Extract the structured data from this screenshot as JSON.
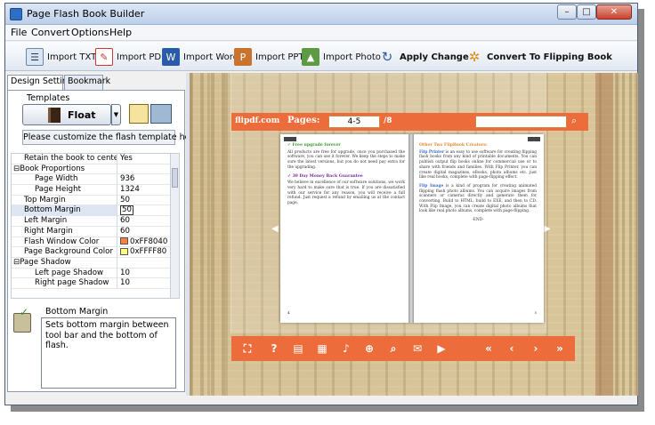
{
  "window": {
    "title": "Page Flash Book Builder",
    "minimize": "–",
    "maximize": "□",
    "close": "✕"
  },
  "menu": [
    "File",
    "Convert",
    "Options",
    "Help"
  ],
  "toolbar": {
    "import_txt": "Import TXT",
    "import_pdf": "Import PDF",
    "import_word": "Import Word",
    "import_ppt": "Import PPT",
    "import_photo": "Import Photo",
    "apply_change": "Apply Change",
    "convert": "Convert To Flipping Book"
  },
  "tabs": {
    "design": "Design Setting",
    "bookmark": "Bookmark"
  },
  "templates": {
    "label": "Templates",
    "selected": "Float",
    "customize": "Please customize the flash template here"
  },
  "properties": [
    {
      "name": "Retain the book to center",
      "value": "Yes",
      "indent": 1
    },
    {
      "name": "⊟Book Proportions",
      "value": "",
      "indent": 0
    },
    {
      "name": "Page Width",
      "value": "936",
      "indent": 2
    },
    {
      "name": "Page Height",
      "value": "1324",
      "indent": 2
    },
    {
      "name": "Top Margin",
      "value": "50",
      "indent": 1
    },
    {
      "name": "Bottom Margin",
      "value": "50",
      "indent": 1,
      "selected": true
    },
    {
      "name": "Left Margin",
      "value": "60",
      "indent": 1
    },
    {
      "name": "Right Margin",
      "value": "60",
      "indent": 1
    },
    {
      "name": "Flash Window Color",
      "value": "0xFF8040",
      "indent": 1,
      "color": "#FF8040"
    },
    {
      "name": "Page Background Color",
      "value": "0xFFFF80",
      "indent": 1,
      "color": "#FFFF80"
    },
    {
      "name": "⊟Page Shadow",
      "value": "",
      "indent": 0
    },
    {
      "name": "Left page Shadow",
      "value": "10",
      "indent": 2
    },
    {
      "name": "Right page Shadow",
      "value": "10",
      "indent": 2
    }
  ],
  "description": {
    "title": "Bottom Margin",
    "text": "Sets bottom margin between tool bar and the bottom of flash."
  },
  "preview": {
    "brand": "flipdf.com",
    "pages_label": "Pages:",
    "page_value": "4-5",
    "page_total": "/8",
    "left_page": {
      "h1": "✓ Free upgrade forever",
      "p1": "All products are free for upgrade, once you purchased the software, you can use it forever. We keep the steps to make sure the latest versions, but you do not need pay extra for the upgrading.",
      "h2": "✓ 30 Day Money Back Guarantee",
      "p2": "We believe in excellence of our software solutions, we work very hard to make sure that is true. If you are dissatisfied with our service for any reason, you will receive a full refund. Just request a refund by emailing us at the contact page.",
      "num": "4"
    },
    "right_page": {
      "h1": "Other Two FlipBook Creators:",
      "p1a": "Flip Printer",
      "p1": " is an easy to use software for creating flipping flash books from any kind of printable documents. You can publish output flip books online for commercial use or to share with friends and families. With Flip Printer, you can create digital magazines, eBooks, photo albums etc. just like real books, complete with page-flipping effect.",
      "p2a": "Flip Image",
      "p2": " is a kind of program for creating animated flipping flash photo albums. You can acquire images from scanners or cameras directly and generate them for converting. Build to HTML, build to EXE, and then to CD. With Flip Image, you can create digital photo albums that look like real photo albums, complete with page-flipping.",
      "end": "-END-",
      "num": "5"
    }
  },
  "colors": {
    "accent": "#EC6D3B",
    "window_border": "#4B5D74"
  }
}
